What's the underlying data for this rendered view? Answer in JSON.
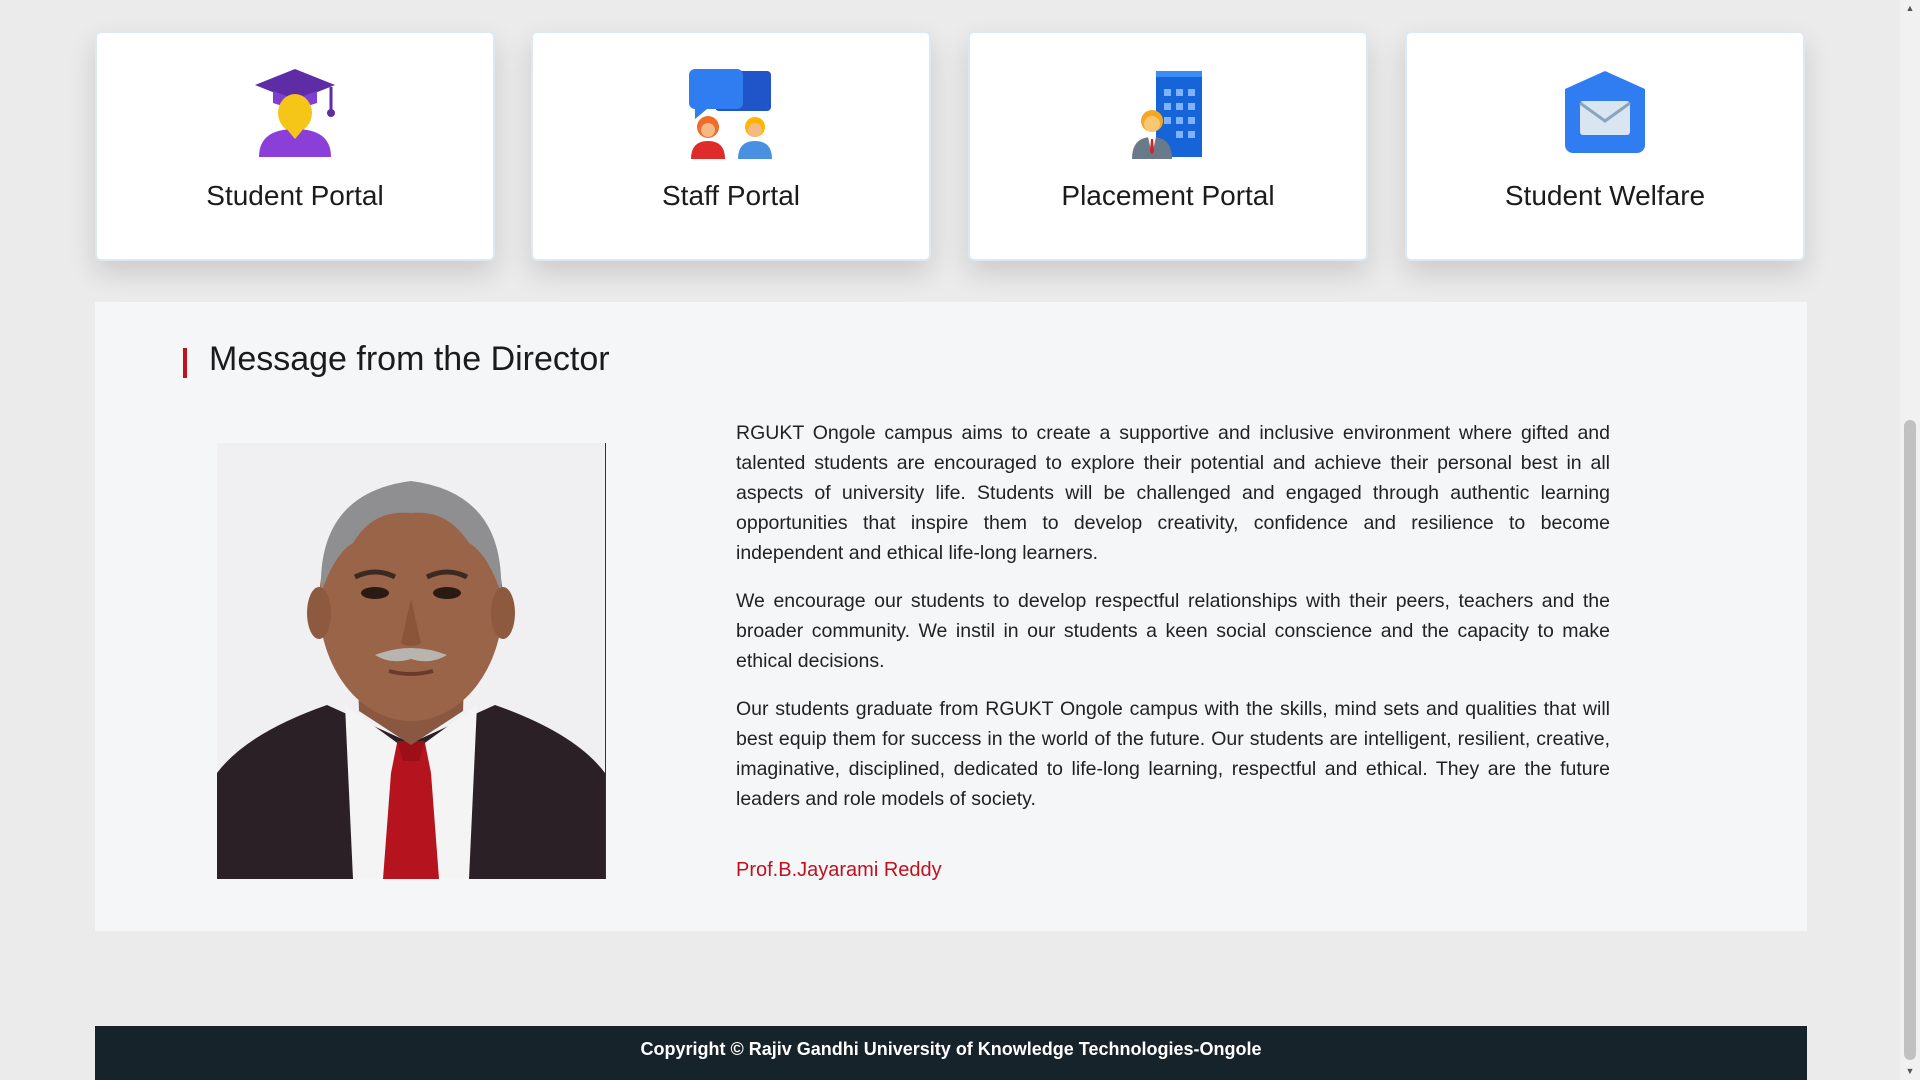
{
  "portals": [
    {
      "label": "Student Portal",
      "icon": "graduate-icon"
    },
    {
      "label": "Staff Portal",
      "icon": "staff-chat-icon"
    },
    {
      "label": "Placement Portal",
      "icon": "office-building-icon"
    },
    {
      "label": "Student Welfare",
      "icon": "mail-icon"
    }
  ],
  "director": {
    "title": "Message from the Director",
    "paragraphs": [
      "RGUKT Ongole campus aims to create a supportive and inclusive environment where gifted and talented students are encouraged to explore their potential and achieve their personal best in all aspects of university life. Students will be challenged and engaged through authentic learning opportunities that inspire them to develop creativity, confidence and resilience to become independent and ethical life-long learners.",
      "We encourage our students to develop respectful relationships with their peers, teachers and the broader community. We instil in our students a keen social conscience and the capacity to make ethical decisions.",
      "Our students graduate from RGUKT Ongole campus with the skills, mind sets and qualities that will best equip them for success in the world of the future. Our students are intelligent, resilient, creative, imaginative, disciplined, dedicated to life-long learning, respectful and ethical. They are the future leaders and role models of society."
    ],
    "signature": "Prof.B.Jayarami Reddy"
  },
  "footer": {
    "copyright": "Copyright © Rajiv Gandhi University of Knowledge Technologies-Ongole"
  },
  "colors": {
    "accent_red": "#c0111f",
    "footer_bg": "#17232b",
    "section_bg": "#f5f6f8"
  }
}
